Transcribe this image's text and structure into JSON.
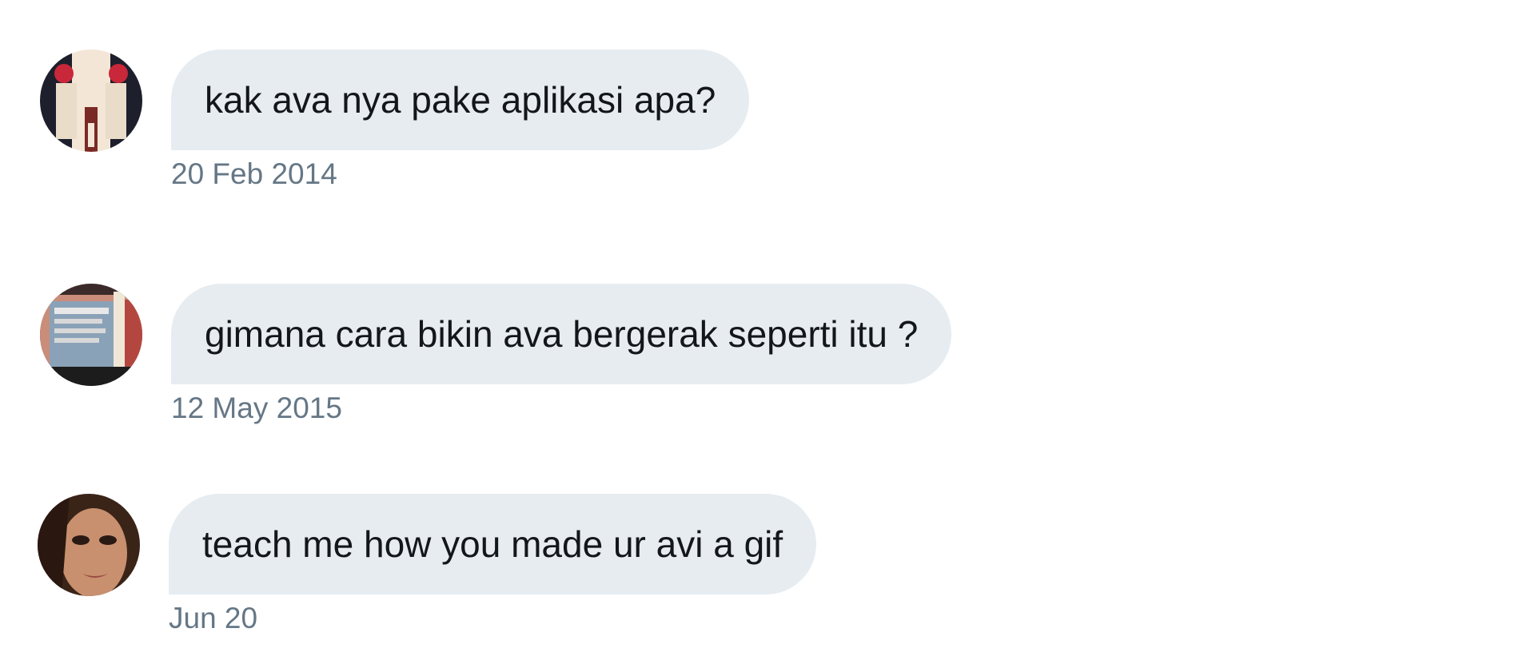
{
  "messages": [
    {
      "text": "kak ava nya pake aplikasi apa?",
      "time": "20 Feb 2014",
      "avatar_icon": "user-avatar-icon"
    },
    {
      "text": "gimana cara bikin ava bergerak seperti itu ?",
      "time": "12 May 2015",
      "avatar_icon": "user-avatar-icon"
    },
    {
      "text": "teach me how you made ur avi a gif",
      "time": "Jun 20",
      "avatar_icon": "user-avatar-icon"
    }
  ],
  "colors": {
    "bubble_bg": "#e6ecf0",
    "text": "#14171a",
    "timestamp": "#657786",
    "background": "#ffffff"
  }
}
